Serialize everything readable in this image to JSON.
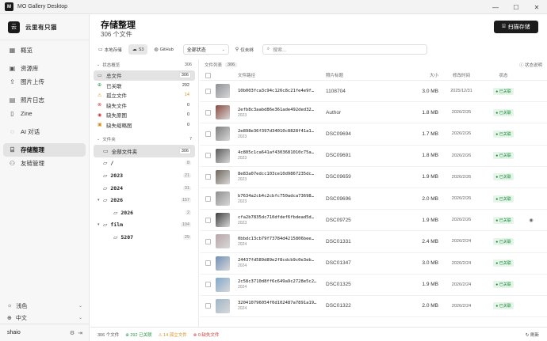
{
  "titlebar": {
    "app_icon": "M",
    "title": "MO Gallery Desktop",
    "minimize": "—",
    "maximize": "☐",
    "close": "✕"
  },
  "sidebar": {
    "brand_logo": "云",
    "brand_name": "云里有只猫",
    "nav": [
      {
        "label": "概览",
        "icon": "grid-icon"
      },
      {
        "label": "资源库",
        "icon": "image-icon"
      },
      {
        "label": "图片上传",
        "icon": "upload-icon"
      },
      {
        "label": "照片日志",
        "icon": "book-icon"
      },
      {
        "label": "Zine",
        "icon": "file-icon"
      },
      {
        "label": "AI 对话",
        "icon": "chat-icon"
      },
      {
        "label": "存储整理",
        "icon": "storage-icon"
      },
      {
        "label": "友链管理",
        "icon": "users-icon"
      }
    ],
    "theme": "浅色",
    "language": "中文",
    "user": "shaio"
  },
  "main": {
    "title": "存储整理",
    "subtitle": "306 个文件",
    "scan_button": "扫描存储",
    "tabs": [
      {
        "label": "本地存储",
        "icon": "hdd-icon"
      },
      {
        "label": "S3",
        "icon": "cloud-icon"
      },
      {
        "label": "GitHub",
        "icon": "github-icon"
      }
    ],
    "status_select": "全部状态",
    "archive_label": "仅未绑",
    "search_placeholder": "搜索..."
  },
  "status_section": {
    "title": "状态概览",
    "count": "306",
    "items": [
      {
        "label": "总文件",
        "count": "306",
        "icon": "▭",
        "color": "#555555"
      },
      {
        "label": "已关联",
        "count": "292",
        "icon": "⊕",
        "color": "#2a9a46"
      },
      {
        "label": "孤立文件",
        "count": "14",
        "icon": "⚠",
        "color": "#d8911c"
      },
      {
        "label": "缺失文件",
        "count": "0",
        "icon": "⊗",
        "color": "#d43a3a"
      },
      {
        "label": "缺失原图",
        "count": "0",
        "icon": "◉",
        "color": "#d43a3a"
      },
      {
        "label": "缺失缩略图",
        "count": "0",
        "icon": "▣",
        "color": "#d8911c"
      }
    ]
  },
  "folder_section": {
    "title": "文件夹",
    "count": "7",
    "items": [
      {
        "label": "全部文件夹",
        "count": "306",
        "indent": 0,
        "expand": ""
      },
      {
        "label": "/",
        "count": "8",
        "indent": 0,
        "expand": ""
      },
      {
        "label": "2023",
        "count": "21",
        "indent": 0,
        "expand": ""
      },
      {
        "label": "2024",
        "count": "31",
        "indent": 0,
        "expand": ""
      },
      {
        "label": "2026",
        "count": "157",
        "indent": 0,
        "expand": "▾"
      },
      {
        "label": "2026",
        "count": "2",
        "indent": 1,
        "expand": ""
      },
      {
        "label": "film",
        "count": "104",
        "indent": 0,
        "expand": "▾"
      },
      {
        "label": "5207",
        "count": "29",
        "indent": 1,
        "expand": ""
      }
    ]
  },
  "file_list": {
    "title": "文件列表",
    "count": "306",
    "sort_label": "状态说明",
    "columns": {
      "path": "文件路径",
      "title": "照片标题",
      "size": "大小",
      "date": "修改时间",
      "status": "状态"
    },
    "rows": [
      {
        "path": "10b003fca3c94c126c8c21fe4e9f…",
        "year": "",
        "title": "1108704",
        "size": "3.0 MB",
        "date": "2025/12/31",
        "status": "已关联",
        "thumb": "#8c8f94",
        "action": ""
      },
      {
        "path": "2efb8c3aabd86e361ade492ded32…",
        "year": "2023",
        "title": "Author",
        "size": "1.8 MB",
        "date": "2026/2/26",
        "status": "已关联",
        "thumb": "#8a4a3f",
        "action": ""
      },
      {
        "path": "2e898e36f397d34010c8828f41a1…",
        "year": "2023",
        "title": "DSC09694",
        "size": "1.7 MB",
        "date": "2026/2/26",
        "status": "已关联",
        "thumb": "#7d7d7d",
        "action": ""
      },
      {
        "path": "4c805c1ca641af4303681010c75a…",
        "year": "2023",
        "title": "DSC09691",
        "size": "1.8 MB",
        "date": "2026/2/26",
        "status": "已关联",
        "thumb": "#5a5a5a",
        "action": ""
      },
      {
        "path": "8e83a07edcc103ce10d9867235dc…",
        "year": "2023",
        "title": "DSC09659",
        "size": "1.9 MB",
        "date": "2026/2/26",
        "status": "已关联",
        "thumb": "#6f665a",
        "action": ""
      },
      {
        "path": "b7634a2cb4c2cbfc750adca73698…",
        "year": "2023",
        "title": "DSC09696",
        "size": "2.0 MB",
        "date": "2026/2/26",
        "status": "已关联",
        "thumb": "#8e8e8e",
        "action": ""
      },
      {
        "path": "cfa2b7835dc710dfdef6fbdead5d…",
        "year": "2023",
        "title": "DSC09725",
        "size": "1.9 MB",
        "date": "2026/2/26",
        "status": "已关联",
        "thumb": "#3e3e3e",
        "action": "◉"
      },
      {
        "path": "0bbdc13cb79f73784d4215806bee…",
        "year": "2024",
        "title": "DSC01331",
        "size": "2.4 MB",
        "date": "2026/2/24",
        "status": "已关联",
        "thumb": "#b7a5a8",
        "action": ""
      },
      {
        "path": "24437fd589d89e2f8cdcb9c0e3eb…",
        "year": "2024",
        "title": "DSC01347",
        "size": "3.0 MB",
        "date": "2026/2/24",
        "status": "已关联",
        "thumb": "#6f8fb6",
        "action": ""
      },
      {
        "path": "2c58c3710d8ff6c649a9c2728e5c2…",
        "year": "2024",
        "title": "DSC01325",
        "size": "1.9 MB",
        "date": "2026/2/24",
        "status": "已关联",
        "thumb": "#7fa8c9",
        "action": ""
      },
      {
        "path": "320410796054f0d102487a7891a19…",
        "year": "2024",
        "title": "DSC01322",
        "size": "2.0 MB",
        "date": "2026/2/24",
        "status": "已关联",
        "thumb": "#9fb5c8",
        "action": ""
      }
    ]
  },
  "statusbar": {
    "total": "306 个文件",
    "linked": "292 已关联",
    "orphan": "14 孤立文件",
    "missing": "0 缺失文件",
    "refresh": "刷新"
  },
  "colors": {
    "accent": "#1c1c1c",
    "linked": "#2a9a46",
    "orphan": "#d8911c",
    "missing": "#d43a3a"
  }
}
